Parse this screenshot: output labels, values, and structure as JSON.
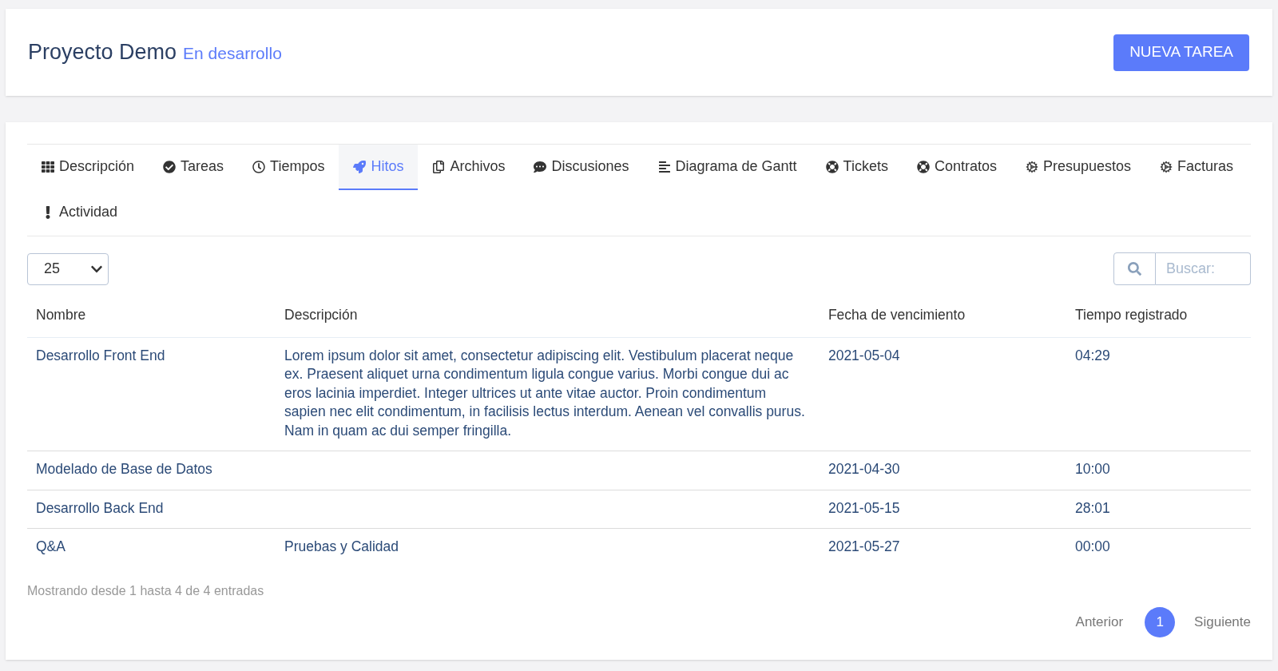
{
  "header": {
    "title": "Proyecto Demo",
    "status": "En desarrollo",
    "button": "NUEVA TAREA"
  },
  "tabs": [
    {
      "label": "Descripción",
      "selected": false
    },
    {
      "label": "Tareas",
      "selected": false
    },
    {
      "label": "Tiempos",
      "selected": false
    },
    {
      "label": "Hitos",
      "selected": true
    },
    {
      "label": "Archivos",
      "selected": false
    },
    {
      "label": "Discusiones",
      "selected": false
    },
    {
      "label": "Diagrama de Gantt",
      "selected": false
    },
    {
      "label": "Tickets",
      "selected": false
    },
    {
      "label": "Contratos",
      "selected": false
    },
    {
      "label": "Presupuestos",
      "selected": false
    },
    {
      "label": "Facturas",
      "selected": false
    },
    {
      "label": "Actividad",
      "selected": false
    }
  ],
  "page_size": "25",
  "search": {
    "placeholder": "Buscar:"
  },
  "table": {
    "columns": [
      "Nombre",
      "Descripción",
      "Fecha de vencimiento",
      "Tiempo registrado"
    ],
    "rows": [
      [
        "Desarrollo Front End",
        "Lorem ipsum dolor sit amet, consectetur adipiscing elit. Vestibulum placerat neque ex. Praesent aliquet urna condimentum ligula congue varius. Morbi congue dui ac eros lacinia imperdiet. Integer ultrices ut ante vitae auctor. Proin condimentum sapien nec elit condimentum, in facilisis lectus interdum. Aenean vel convallis purus. Nam in quam ac dui semper fringilla.",
        "2021-05-04",
        "04:29"
      ],
      [
        "Modelado de Base de Datos",
        "",
        "2021-04-30",
        "10:00"
      ],
      [
        "Desarrollo Back End",
        "",
        "2021-05-15",
        "28:01"
      ],
      [
        "Q&A",
        "Pruebas y Calidad",
        "2021-05-27",
        "00:00"
      ]
    ]
  },
  "info": "Mostrando desde 1 hasta 4 de 4 entradas",
  "pagination": {
    "previous": "Anterior",
    "pages": [
      {
        "label": "1",
        "selected": true
      }
    ],
    "next": "Siguiente"
  }
}
